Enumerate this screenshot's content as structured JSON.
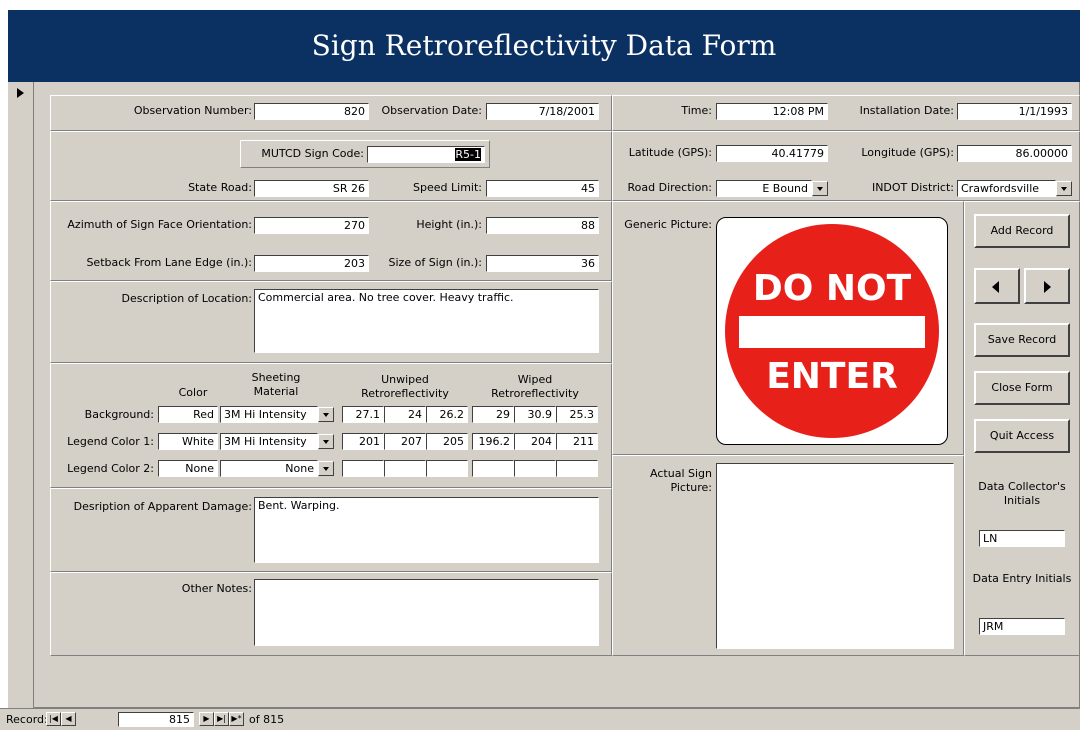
{
  "title": "Sign Retroreflectivity Data Form",
  "fields": {
    "observation_number": {
      "label": "Observation Number:",
      "value": "820"
    },
    "observation_date": {
      "label": "Observation Date:",
      "value": "7/18/2001"
    },
    "time": {
      "label": "Time:",
      "value": "12:08 PM"
    },
    "installation_date": {
      "label": "Installation Date:",
      "value": "1/1/1993"
    },
    "mutcd_sign_code": {
      "label": "MUTCD Sign Code:",
      "value": "R5-1"
    },
    "latitude": {
      "label": "Latitude (GPS):",
      "value": "40.41779"
    },
    "longitude": {
      "label": "Longitude (GPS):",
      "value": "86.00000"
    },
    "state_road": {
      "label": "State Road:",
      "value": "SR 26"
    },
    "speed_limit": {
      "label": "Speed Limit:",
      "value": "45"
    },
    "road_direction": {
      "label": "Road Direction:",
      "value": "E Bound"
    },
    "indot_district": {
      "label": "INDOT District:",
      "value": "Crawfordsville"
    },
    "azimuth": {
      "label": "Azimuth of Sign Face Orientation:",
      "value": "270"
    },
    "height": {
      "label": "Height (in.):",
      "value": "88"
    },
    "setback": {
      "label": "Setback From Lane Edge (in.):",
      "value": "203"
    },
    "size_of_sign": {
      "label": "Size of Sign (in.):",
      "value": "36"
    },
    "description_location": {
      "label": "Description of Location:",
      "value": "Commercial area.  No tree cover.  Heavy traffic."
    },
    "damage": {
      "label": "Desription of Apparent Damage:",
      "value": "Bent. Warping."
    },
    "other_notes": {
      "label": "Other Notes:",
      "value": ""
    },
    "generic_picture": {
      "label": "Generic Picture:"
    },
    "actual_picture": {
      "label": "Actual Sign Picture:"
    },
    "collector_initials": {
      "label": "Data Collector's Initials",
      "value": "LN"
    },
    "entry_initials": {
      "label": "Data Entry Initials",
      "value": "JRM"
    }
  },
  "retro": {
    "headers": {
      "color": "Color",
      "sheeting": "Sheeting Material",
      "unwiped": "Unwiped Retroreflectivity",
      "wiped": "Wiped Retroreflectivity"
    },
    "rows": [
      {
        "label": "Background:",
        "color": "Red",
        "material": "3M Hi Intensity",
        "unwiped": [
          "27.1",
          "24",
          "26.2"
        ],
        "wiped": [
          "29",
          "30.9",
          "25.3"
        ]
      },
      {
        "label": "Legend Color 1:",
        "color": "White",
        "material": "3M Hi Intensity",
        "unwiped": [
          "201",
          "207",
          "205"
        ],
        "wiped": [
          "196.2",
          "204",
          "211"
        ]
      },
      {
        "label": "Legend Color 2:",
        "color": "None",
        "material": "None",
        "unwiped": [
          "",
          "",
          ""
        ],
        "wiped": [
          "",
          "",
          ""
        ]
      }
    ]
  },
  "sign": {
    "line1": "DO NOT",
    "line2": "ENTER",
    "color": "#e8201a"
  },
  "buttons": {
    "add": "Add Record",
    "save": "Save Record",
    "close": "Close Form",
    "quit": "Quit Access"
  },
  "record_nav": {
    "label": "Record:",
    "current": "815",
    "of_label": "of 815"
  },
  "colors": {
    "titlebar": "#0b3163",
    "form_bg": "#d4d0c8"
  }
}
